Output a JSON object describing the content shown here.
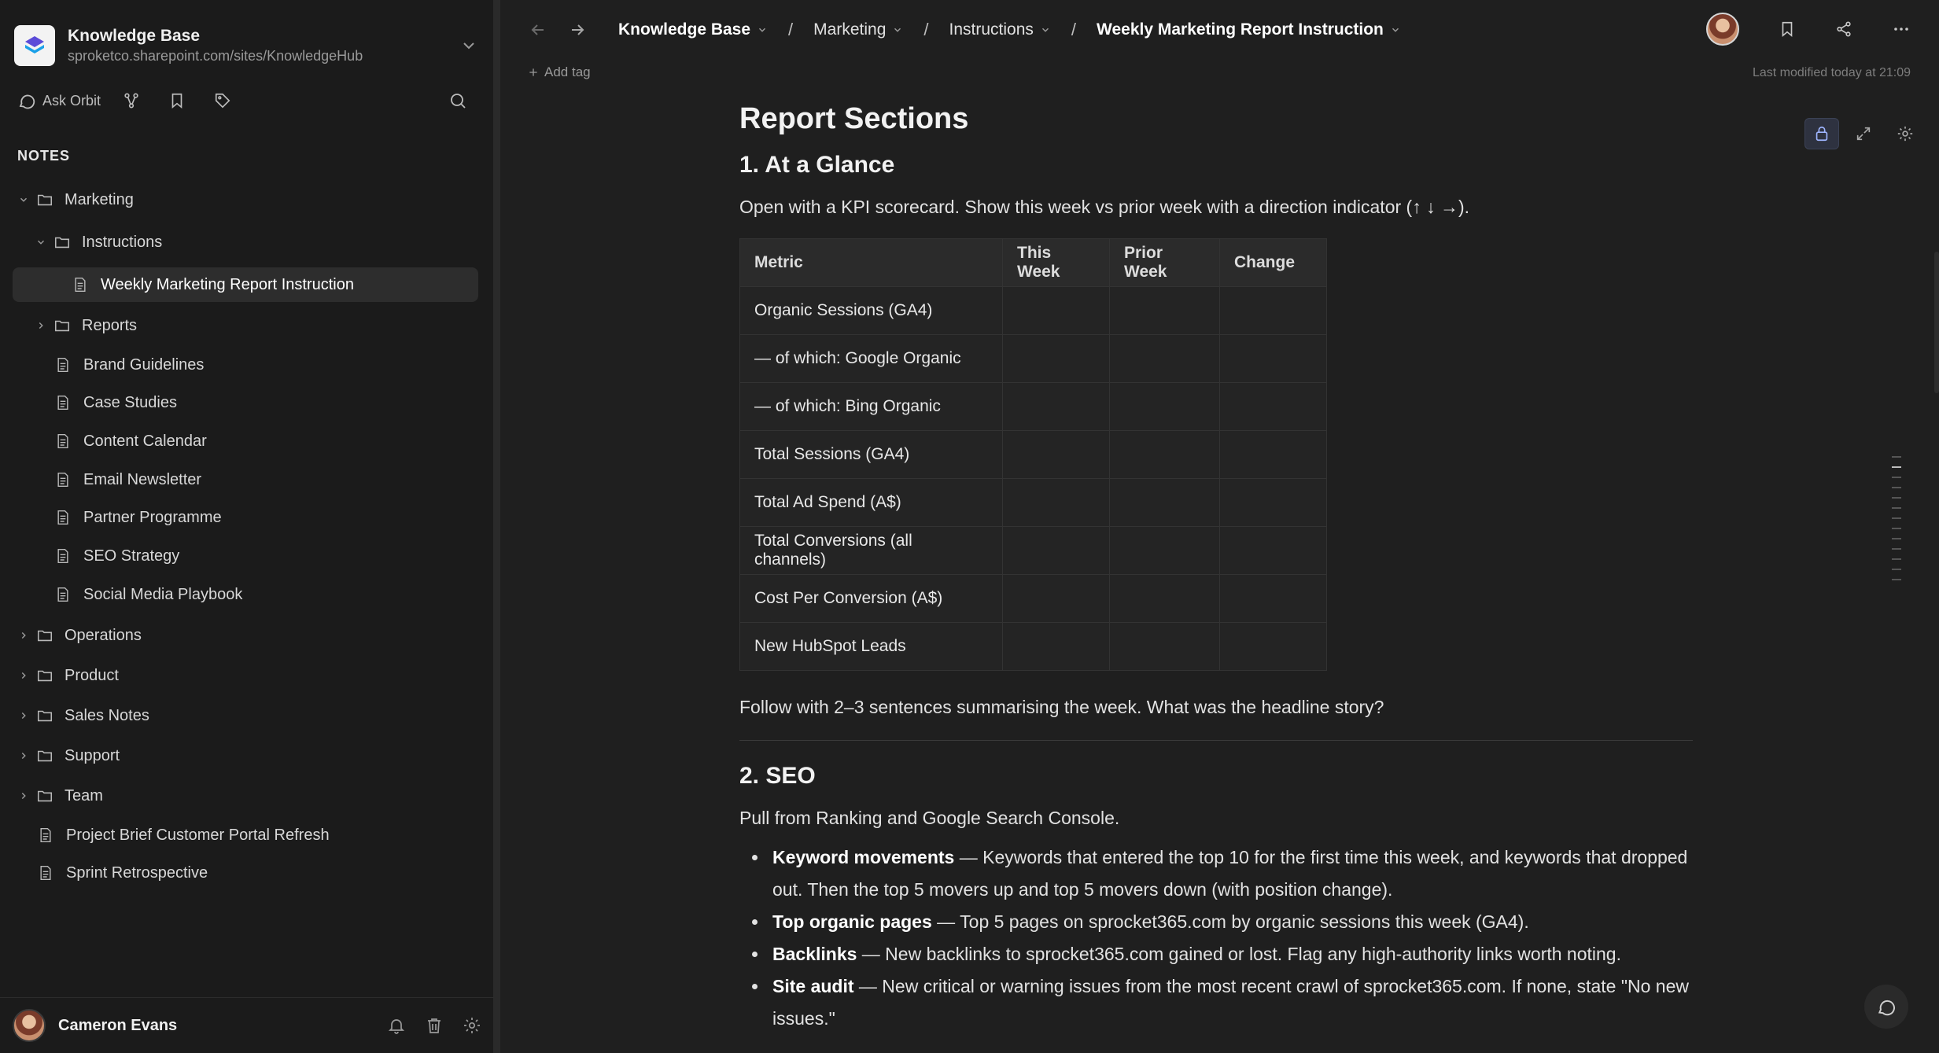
{
  "workspace": {
    "title": "Knowledge Base",
    "url": "sproketco.sharepoint.com/sites/KnowledgeHub"
  },
  "sidebar_tools": {
    "ask": "Ask Orbit"
  },
  "notes_label": "NOTES",
  "tree": {
    "marketing": "Marketing",
    "instructions": "Instructions",
    "weekly": "Weekly Marketing Report Instruction",
    "reports": "Reports",
    "brand": "Brand Guidelines",
    "case": "Case Studies",
    "content": "Content Calendar",
    "email": "Email Newsletter",
    "partner": "Partner Programme",
    "seo": "SEO Strategy",
    "social": "Social Media Playbook",
    "operations": "Operations",
    "product": "Product",
    "sales": "Sales Notes",
    "support": "Support",
    "team": "Team",
    "project": "Project Brief Customer Portal Refresh",
    "sprint": "Sprint Retrospective"
  },
  "user": {
    "name": "Cameron Evans"
  },
  "breadcrumb": {
    "c1": "Knowledge Base",
    "c2": "Marketing",
    "c3": "Instructions",
    "c4": "Weekly Marketing Report Instruction",
    "sep": "/"
  },
  "add_tag": "Add tag",
  "last_modified": "Last modified today at 21:09",
  "doc": {
    "title": "Report Sections",
    "s1_heading": "1. At a Glance",
    "s1_intro": "Open with a KPI scorecard. Show this week vs prior week with a direction indicator (↑ ↓ →).",
    "table_headers": [
      "Metric",
      "This Week",
      "Prior Week",
      "Change"
    ],
    "table_rows": [
      "Organic Sessions (GA4)",
      "— of which: Google Organic",
      "— of which: Bing Organic",
      "Total Sessions (GA4)",
      "Total Ad Spend (A$)",
      "Total Conversions (all channels)",
      "Cost Per Conversion (A$)",
      "New HubSpot Leads"
    ],
    "s1_follow": "Follow with 2–3 sentences summarising the week. What was the headline story?",
    "s2_heading": "2. SEO",
    "s2_intro": "Pull from Ranking and Google Search Console.",
    "bullets": [
      {
        "b": "Keyword movements",
        "t": " — Keywords that entered the top 10 for the first time this week, and keywords that dropped out. Then the top 5 movers up and top 5 movers down (with position change)."
      },
      {
        "b": "Top organic pages",
        "t": " — Top 5 pages on sprocket365.com by organic sessions this week (GA4)."
      },
      {
        "b": "Backlinks",
        "t": " — New backlinks to sprocket365.com gained or lost. Flag any high-authority links worth noting."
      },
      {
        "b": "Site audit",
        "t": " — New critical or warning issues from the most recent crawl of sprocket365.com. If none, state \"No new issues.\""
      }
    ]
  },
  "colors": {
    "background": "#1f1f1f",
    "sidebar": "#1b1b1b",
    "accent": "#9fb5ff"
  }
}
